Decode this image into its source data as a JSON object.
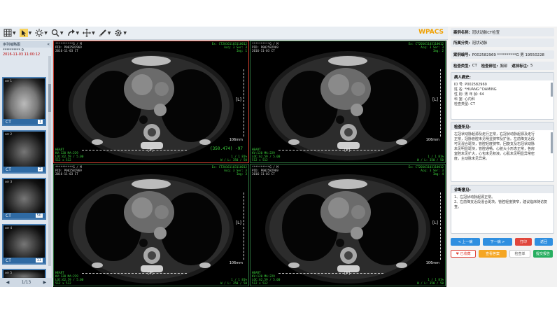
{
  "app": {
    "brand": "WPACS"
  },
  "toolbar": {
    "buttons": [
      "layout-grid",
      "pointer",
      "brightness",
      "zoom",
      "rotate",
      "pan",
      "measure",
      "settings"
    ]
  },
  "thumbnails": {
    "header": "序列缩略图",
    "patient": "********** 0",
    "date": "2016-11-03 11:00:12",
    "series": [
      {
        "label": "ser 1",
        "modality": "CT",
        "count": "1"
      },
      {
        "label": "ser 2",
        "modality": "CT",
        "count": "2"
      },
      {
        "label": "ser 3",
        "modality": "CT",
        "count": "50"
      },
      {
        "label": "ser 4",
        "modality": "CT",
        "count": "11"
      },
      {
        "label": "ser 5",
        "modality": "CT",
        "count": ""
      }
    ],
    "pager": "1/13"
  },
  "viewports": [
    {
      "tl": [
        "**********G / M",
        "PID: P002582969",
        "2016-11-03 CT"
      ],
      "tr": [
        "Ex: CT20161103110012",
        "Acq: 3 Ser: 3",
        "Img: 1"
      ],
      "bl": [
        "HEART",
        "KV:120 MA:229",
        "LOC:62.59 / 5.00",
        "512 x 512"
      ],
      "br": [
        "1 / 1   81%",
        "W / L: 350 / 50"
      ],
      "orient_r": "[L]",
      "orient_b": "[P]",
      "mm": "106mm",
      "hu": "(350.474)  -97"
    },
    {
      "tl": [
        "**********G / M",
        "PID: P002582969",
        "2016-11-03 CT"
      ],
      "tr": [
        "Ex: CT20161103110012",
        "Acq: 3 Ser: 3",
        "Img: 2"
      ],
      "bl": [
        "HEART",
        "KV:120 MA:229",
        "LOC:62.59 / 5.00",
        "512 x 512"
      ],
      "br": [
        "1 / 1   81%",
        "W / L: 350 / 50"
      ],
      "orient_r": "[L]",
      "orient_b": "[P]",
      "mm": "106mm",
      "hu": ""
    },
    {
      "tl": [
        "**********G / M",
        "PID: P002582969",
        "2016-11-03 CT"
      ],
      "tr": [
        "Ex: CT20161103110012",
        "Acq: 3 Ser: 3",
        "Img: 3"
      ],
      "bl": [
        "HEART",
        "KV:120 MA:229",
        "LOC:62.59 / 5.00",
        "512 x 512"
      ],
      "br": [
        "1 / 1   81%",
        "W / L: 350 / 50"
      ],
      "orient_r": "[L]",
      "orient_b": "[P]",
      "mm": "106mm",
      "hu": ""
    },
    {
      "tl": [
        "**********G / M",
        "PID: P002582969",
        "2016-11-03 CT"
      ],
      "tr": [
        "Ex: CT20161103110012",
        "Acq: 3 Ser: 3",
        "Img: 4"
      ],
      "bl": [
        "HEART",
        "KV:120 MA:229",
        "LOC:62.59 / 5.00",
        "512 x 512"
      ],
      "br": [
        "1 / 1   81%",
        "W / L: 350 / 50"
      ],
      "orient_r": "[L]",
      "orient_b": "[P]",
      "mm": "106mm",
      "hu": ""
    }
  ],
  "report": {
    "case_name_label": "案例名称:",
    "case_name": "冠状动脉CT检查",
    "category_label": "所属分类:",
    "category": "冠状动脉",
    "case_no_label": "案例编号:",
    "case_no": "P002582969 **********G 男 19550228",
    "exam_type_label": "检查类型:",
    "exam_type": "CT",
    "exam_part_label": "检查部位:",
    "exam_part": "胸部",
    "ann_label": "遮挡标注:",
    "ann": "5",
    "history_title": "病人病史:",
    "history_lines": [
      "ID 号: P002582969",
      "姓 名: *HUANG^DAMING",
      "性 别: 男    年 龄: 64",
      "科 室: 心内科",
      "检查类型: CT"
    ],
    "findings_title": "检查所见:",
    "findings_lines": [
      "左冠状动脉起源及走行正常，右冠状动脉起源及走行",
      "正常，冠脉管腔未见明显狭窄及扩张。左前降支近段",
      "可见混合斑块，管腔轻度狭窄。回旋支及右冠状动脉",
      "未见明显斑块，管腔通畅。心脏大小形态正常，各房",
      "室腔未见扩大，心包未见积液。心肌未见明显异常密",
      "度，主动脉未见异常。"
    ],
    "impression_title": "诊断意见:",
    "impression_lines": [
      "1、左冠状动脉起源正常。",
      "2、左前降支近段混合斑块，管腔轻度狭窄，建议临床随访复查。"
    ],
    "buttons": {
      "prev": "< 上一病",
      "next": "下一病 >",
      "print": "打印",
      "back": "返回",
      "collect": "♥ 已收藏",
      "show_answer": "查看答案",
      "check_report": "检查单",
      "submit": "提交报告"
    },
    "colors": {
      "blue": "#2f8fe0",
      "red": "#e0463c",
      "orange": "#f5a623",
      "green": "#27ae60"
    }
  }
}
